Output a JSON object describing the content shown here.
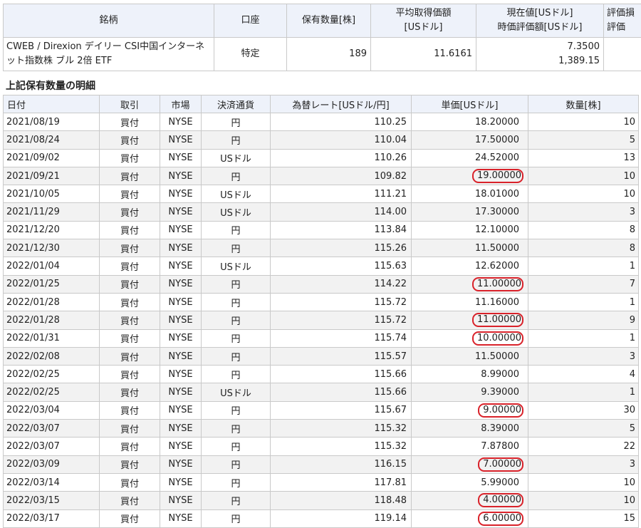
{
  "summary": {
    "headers": [
      "銘柄",
      "口座",
      "保有数量[株]",
      "平均取得価額\n[USドル]",
      "現在値[USドル]\n時価評価額[USドル]",
      "評価損\n評価"
    ],
    "row": {
      "name": "CWEB / Direxion デイリー CSI中国インターネット指数株 ブル 2倍 ETF",
      "account": "特定",
      "holding_qty": "189",
      "avg_cost": "11.6161",
      "current_price": "7.3500",
      "market_value": "1,389.15"
    }
  },
  "section_title": "上記保有数量の明細",
  "detail": {
    "headers": [
      "日付",
      "取引",
      "市場",
      "決済通貨",
      "為替レート[USドル/円]",
      "単価[USドル]",
      "数量[株]"
    ],
    "rows": [
      {
        "date": "2021/08/19",
        "trade": "買付",
        "market": "NYSE",
        "currency": "円",
        "rate": "110.25",
        "price": "18.20000",
        "qty": "10",
        "circled": false
      },
      {
        "date": "2021/08/24",
        "trade": "買付",
        "market": "NYSE",
        "currency": "円",
        "rate": "110.04",
        "price": "17.50000",
        "qty": "5",
        "circled": false
      },
      {
        "date": "2021/09/02",
        "trade": "買付",
        "market": "NYSE",
        "currency": "USドル",
        "rate": "110.26",
        "price": "24.52000",
        "qty": "13",
        "circled": false
      },
      {
        "date": "2021/09/21",
        "trade": "買付",
        "market": "NYSE",
        "currency": "円",
        "rate": "109.82",
        "price": "19.00000",
        "qty": "10",
        "circled": true
      },
      {
        "date": "2021/10/05",
        "trade": "買付",
        "market": "NYSE",
        "currency": "USドル",
        "rate": "111.21",
        "price": "18.01000",
        "qty": "10",
        "circled": false
      },
      {
        "date": "2021/11/29",
        "trade": "買付",
        "market": "NYSE",
        "currency": "USドル",
        "rate": "114.00",
        "price": "17.30000",
        "qty": "3",
        "circled": false
      },
      {
        "date": "2021/12/20",
        "trade": "買付",
        "market": "NYSE",
        "currency": "円",
        "rate": "113.84",
        "price": "12.10000",
        "qty": "8",
        "circled": false
      },
      {
        "date": "2021/12/30",
        "trade": "買付",
        "market": "NYSE",
        "currency": "円",
        "rate": "115.26",
        "price": "11.50000",
        "qty": "8",
        "circled": false
      },
      {
        "date": "2022/01/04",
        "trade": "買付",
        "market": "NYSE",
        "currency": "USドル",
        "rate": "115.63",
        "price": "12.62000",
        "qty": "1",
        "circled": false
      },
      {
        "date": "2022/01/25",
        "trade": "買付",
        "market": "NYSE",
        "currency": "円",
        "rate": "114.22",
        "price": "11.00000",
        "qty": "7",
        "circled": true
      },
      {
        "date": "2022/01/28",
        "trade": "買付",
        "market": "NYSE",
        "currency": "円",
        "rate": "115.72",
        "price": "11.16000",
        "qty": "1",
        "circled": false
      },
      {
        "date": "2022/01/28",
        "trade": "買付",
        "market": "NYSE",
        "currency": "円",
        "rate": "115.72",
        "price": "11.00000",
        "qty": "9",
        "circled": true
      },
      {
        "date": "2022/01/31",
        "trade": "買付",
        "market": "NYSE",
        "currency": "円",
        "rate": "115.74",
        "price": "10.00000",
        "qty": "1",
        "circled": true
      },
      {
        "date": "2022/02/08",
        "trade": "買付",
        "market": "NYSE",
        "currency": "円",
        "rate": "115.57",
        "price": "11.50000",
        "qty": "3",
        "circled": false
      },
      {
        "date": "2022/02/25",
        "trade": "買付",
        "market": "NYSE",
        "currency": "円",
        "rate": "115.66",
        "price": "8.99000",
        "qty": "4",
        "circled": false
      },
      {
        "date": "2022/02/25",
        "trade": "買付",
        "market": "NYSE",
        "currency": "USドル",
        "rate": "115.66",
        "price": "9.39000",
        "qty": "1",
        "circled": false
      },
      {
        "date": "2022/03/04",
        "trade": "買付",
        "market": "NYSE",
        "currency": "円",
        "rate": "115.67",
        "price": "9.00000",
        "qty": "30",
        "circled": true
      },
      {
        "date": "2022/03/07",
        "trade": "買付",
        "market": "NYSE",
        "currency": "円",
        "rate": "115.32",
        "price": "8.39000",
        "qty": "5",
        "circled": false
      },
      {
        "date": "2022/03/07",
        "trade": "買付",
        "market": "NYSE",
        "currency": "円",
        "rate": "115.32",
        "price": "7.87800",
        "qty": "22",
        "circled": false
      },
      {
        "date": "2022/03/09",
        "trade": "買付",
        "market": "NYSE",
        "currency": "円",
        "rate": "116.15",
        "price": "7.00000",
        "qty": "3",
        "circled": true
      },
      {
        "date": "2022/03/14",
        "trade": "買付",
        "market": "NYSE",
        "currency": "円",
        "rate": "117.81",
        "price": "5.99000",
        "qty": "10",
        "circled": false
      },
      {
        "date": "2022/03/15",
        "trade": "買付",
        "market": "NYSE",
        "currency": "円",
        "rate": "118.48",
        "price": "4.00000",
        "qty": "10",
        "circled": true
      },
      {
        "date": "2022/03/17",
        "trade": "買付",
        "market": "NYSE",
        "currency": "円",
        "rate": "119.14",
        "price": "6.00000",
        "qty": "15",
        "circled": true
      }
    ]
  },
  "colors": {
    "header_bg": "#eef2fa",
    "alt_row_bg": "#f2f2f2",
    "border": "#c9c9c9",
    "highlight_circle": "#d9222a"
  }
}
